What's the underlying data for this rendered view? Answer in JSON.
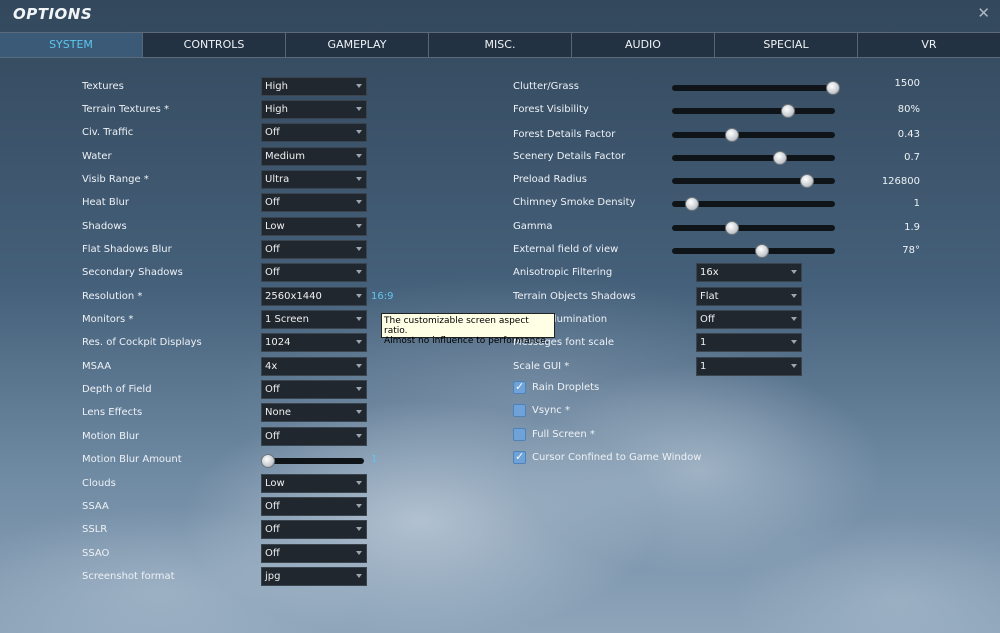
{
  "window": {
    "title": "OPTIONS",
    "close_icon": "close-icon"
  },
  "tabs": [
    {
      "label": "SYSTEM",
      "active": true
    },
    {
      "label": "CONTROLS"
    },
    {
      "label": "GAMEPLAY"
    },
    {
      "label": "MISC."
    },
    {
      "label": "AUDIO"
    },
    {
      "label": "SPECIAL"
    },
    {
      "label": "VR"
    }
  ],
  "left": {
    "settings": [
      {
        "label": "Textures",
        "value": "High"
      },
      {
        "label": "Terrain Textures *",
        "value": "High"
      },
      {
        "label": "Civ. Traffic",
        "value": "Off"
      },
      {
        "label": "Water",
        "value": "Medium"
      },
      {
        "label": "Visib Range *",
        "value": "Ultra"
      },
      {
        "label": "Heat Blur",
        "value": "Off"
      },
      {
        "label": "Shadows",
        "value": "Low"
      },
      {
        "label": "Flat Shadows Blur",
        "value": "Off"
      },
      {
        "label": "Secondary Shadows",
        "value": "Off"
      },
      {
        "label": "Resolution *",
        "value": "2560x1440"
      },
      {
        "label": "Monitors *",
        "value": "1 Screen"
      },
      {
        "label": "Res. of Cockpit Displays",
        "value": "1024"
      },
      {
        "label": "MSAA",
        "value": "4x"
      },
      {
        "label": "Depth of Field",
        "value": "Off"
      },
      {
        "label": "Lens Effects",
        "value": "None"
      },
      {
        "label": "Motion Blur",
        "value": "Off"
      },
      {
        "label": "Motion Blur Amount",
        "value": "1"
      },
      {
        "label": "Clouds",
        "value": "Low"
      },
      {
        "label": "SSAA",
        "value": "Off"
      },
      {
        "label": "SSLR",
        "value": "Off"
      },
      {
        "label": "SSAO",
        "value": "Off"
      },
      {
        "label": "Screenshot format",
        "value": "jpg"
      }
    ],
    "aspect_ratio": "16:9",
    "motion_blur_amount_fraction": 0.0
  },
  "right": {
    "sliders": [
      {
        "label": "Clutter/Grass",
        "value": "1500",
        "fraction": 0.99
      },
      {
        "label": "Forest Visibility",
        "value": "80%",
        "fraction": 0.71
      },
      {
        "label": "Forest Details Factor",
        "value": "0.43",
        "fraction": 0.37
      },
      {
        "label": "Scenery Details Factor",
        "value": "0.7",
        "fraction": 0.66
      },
      {
        "label": "Preload Radius",
        "value": "126800",
        "fraction": 0.83
      },
      {
        "label": "Chimney Smoke Density",
        "value": "1",
        "fraction": 0.12
      },
      {
        "label": "Gamma",
        "value": "1.9",
        "fraction": 0.37
      },
      {
        "label": "External field of view",
        "value": "78°",
        "fraction": 0.55
      }
    ],
    "dropdowns": [
      {
        "label": "Anisotropic Filtering",
        "value": "16x"
      },
      {
        "label": "Terrain Objects Shadows",
        "value": "Flat"
      },
      {
        "label": "Global Illumination",
        "value": "Off"
      },
      {
        "label": "Messages font scale",
        "value": "1"
      },
      {
        "label": "Scale GUI *",
        "value": "1"
      }
    ],
    "checkboxes": [
      {
        "label": "Rain Droplets",
        "checked": true
      },
      {
        "label": "Vsync *",
        "checked": false
      },
      {
        "label": "Full Screen *",
        "checked": false
      },
      {
        "label": "Cursor Confined to Game Window",
        "checked": true
      }
    ]
  },
  "tooltip": {
    "line1": "The customizable screen aspect ratio.",
    "line2": "Almost no influence to performance."
  },
  "colors": {
    "accent": "#5fc6ee",
    "active_tab_bg": "#3a5a78",
    "dropdown_bg": "#20272f",
    "checkbox_fill": "#6fa2d8"
  }
}
